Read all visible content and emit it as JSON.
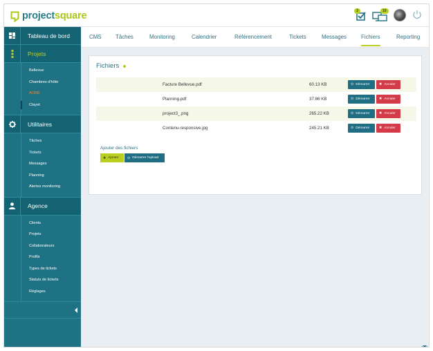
{
  "brand": {
    "part1": "project",
    "part2": "square",
    "primary": "#2a7b8a",
    "accent": "#a9c81c"
  },
  "header": {
    "tasks_badge": "3",
    "screens_badge": "10",
    "icons": [
      "tasks-check-icon",
      "screens-icon",
      "avatar",
      "power-icon"
    ]
  },
  "sidebar": {
    "sections": [
      {
        "label": "Tableau de bord",
        "icon": "dashboard-icon",
        "items": []
      },
      {
        "label": "Projets",
        "icon": "projects-icon",
        "active": true,
        "items": [
          "Bellevue",
          "Chambres d'hôte",
          "AORE",
          "Clayet"
        ]
      },
      {
        "label": "Utilitaires",
        "icon": "gear-icon",
        "items": [
          "Tâches",
          "Tickets",
          "Messages",
          "Planning",
          "Alertes monitoring"
        ]
      },
      {
        "label": "Agence",
        "icon": "user-icon",
        "items": [
          "Clients",
          "Projets",
          "Collaborateurs",
          "Profils",
          "Types de tickets",
          "Statuts de tickets",
          "Réglages"
        ]
      }
    ]
  },
  "tabs": [
    "CMS",
    "Tâches",
    "Monitoring",
    "Calendrier",
    "Référencement",
    "Tickets",
    "Messages",
    "Fichiers",
    "Reporting"
  ],
  "active_tab": "Fichiers",
  "panel": {
    "title": "Fichiers",
    "files": [
      {
        "name": "Facture Bellevue.pdf",
        "size": "60.13 KB"
      },
      {
        "name": "Planning.pdf",
        "size": "37.86 KB"
      },
      {
        "name": "project3_.png",
        "size": "265.22 KB"
      },
      {
        "name": "Contenu-responsive.jpg",
        "size": "245.21 KB"
      }
    ],
    "start_label": "Démarrer",
    "cancel_label": "Annuler",
    "add_title": "Ajouter des fichiers",
    "add_label": "Ajouter",
    "upload_label": "Démarrer l'upload"
  }
}
